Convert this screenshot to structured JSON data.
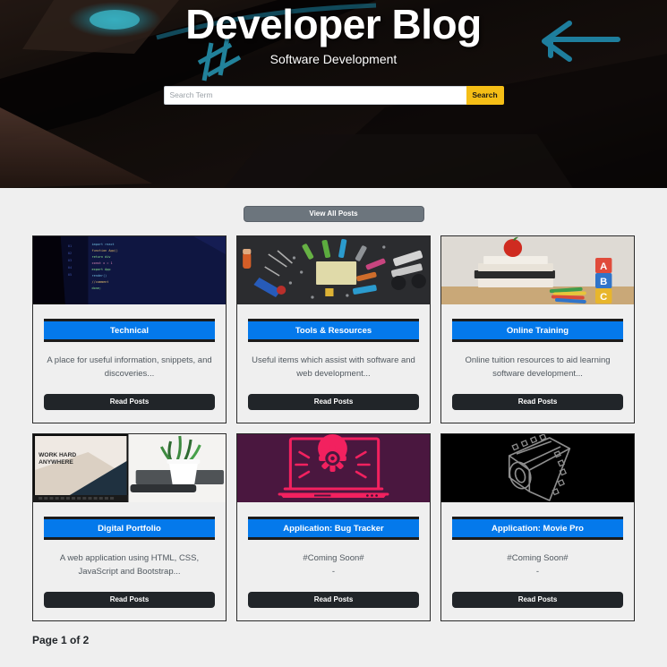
{
  "hero": {
    "title": "Developer Blog",
    "subtitle": "Software Development",
    "background_image": "dark-keyboard-closeup-with-blue-backlit-keys",
    "search": {
      "placeholder": "Search Term",
      "value": "",
      "button_label": "Search",
      "button_color": "#f5be16"
    }
  },
  "main": {
    "view_all_label": "View All Posts",
    "view_all_color": "#6c757d",
    "accent_color": "#0479eb",
    "read_button_color": "#212529",
    "page_background": "#efefef",
    "cards": [
      {
        "title": "Technical",
        "description": "A place for useful information, snippets, and discoveries...",
        "button_label": "Read Posts",
        "image": "code-editor-on-dark-monitor"
      },
      {
        "title": "Tools & Resources",
        "description": "Useful items which assist with software and web development...",
        "button_label": "Read Posts",
        "image": "stationery-flat-lay-on-dark-desk"
      },
      {
        "title": "Online Training",
        "description": "Online tuition resources to aid learning software development...",
        "button_label": "Read Posts",
        "image": "apple-on-books-with-abc-blocks"
      },
      {
        "title": "Digital Portfolio",
        "description": "A web application using HTML, CSS, JavaScript and Bootstrap...",
        "button_label": "Read Posts",
        "image": "laptop-work-hard-anywhere-with-plant"
      },
      {
        "title": "Application: Bug Tracker",
        "description": "#Coming Soon#\n-",
        "button_label": "Read Posts",
        "image": "pink-bug-in-laptop-icon-on-purple"
      },
      {
        "title": "Application: Movie Pro",
        "description": "#Coming Soon#\n-",
        "button_label": "Read Posts",
        "image": "film-strip-outline-on-black"
      }
    ],
    "pagination_label": "Page 1 of 2"
  }
}
